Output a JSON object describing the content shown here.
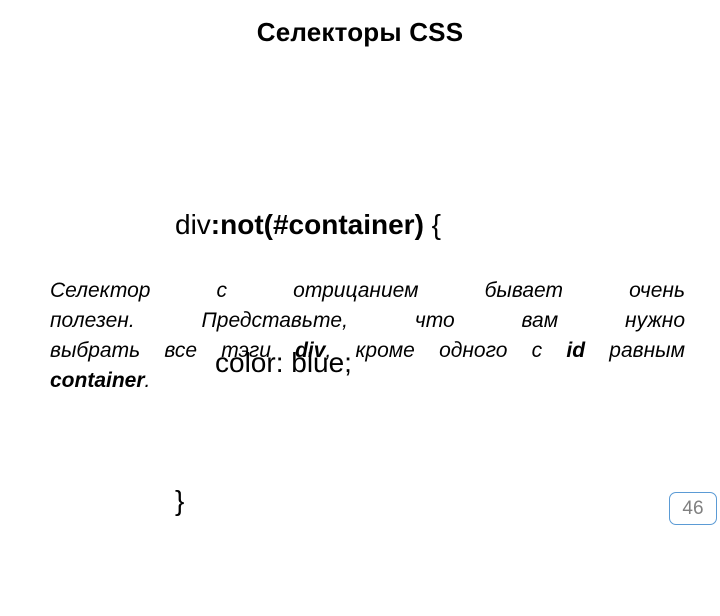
{
  "slide": {
    "title": "Селекторы CSS",
    "code": {
      "line1": {
        "tag": "div",
        "pseudo": ":not(#container)",
        "brace": " {"
      },
      "line2": "color: blue;",
      "line3": "}"
    },
    "paragraph": {
      "line1": "Селектор с отрицанием бывает очень",
      "line2": "полезен. Представьте, что вам нужно",
      "line3_part1": "выбрать все тэги ",
      "line3_kw1": "div",
      "line3_part2": ", кроме одного с ",
      "line3_kw2": "id",
      "line3_part3": " равным",
      "line4_kw": "container",
      "line4_end": "."
    },
    "page_number": "46",
    "colors": {
      "badge_border": "#5B9BD5",
      "badge_text": "#808080",
      "text": "#000000",
      "background": "#ffffff"
    }
  }
}
